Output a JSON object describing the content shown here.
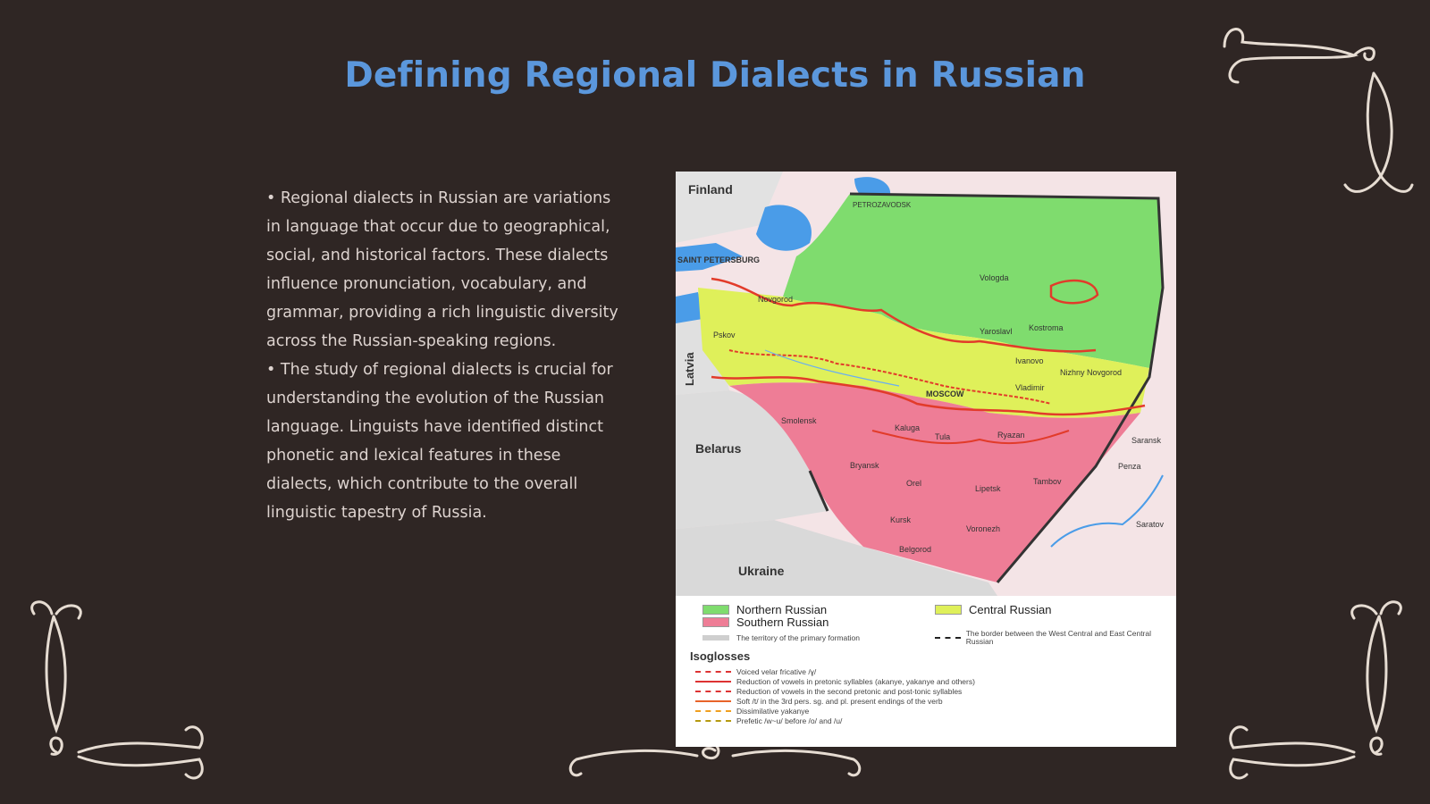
{
  "slide": {
    "title": "Defining Regional Dialects in Russian",
    "bullets": [
      "• Regional dialects in Russian are variations in language that occur due to geographical, social, and historical factors. These dialects influence pronunciation, vocabulary, and grammar, providing a rich linguistic diversity across the Russian-speaking regions.",
      "• The study of regional dialects is crucial for understanding the evolution of the Russian language. Linguists have identified distinct phonetic and lexical features in these dialects, which contribute to the overall linguistic tapestry of Russia."
    ]
  },
  "map": {
    "countries": {
      "finland": "Finland",
      "latvia": "Latvia",
      "belarus": "Belarus",
      "ukraine": "Ukraine"
    },
    "cities": {
      "saint_petersburg": "SAINT PETERSBURG",
      "petrozavodsk": "PETROZAVODSK",
      "novgorod": "Novgorod",
      "pskov": "Pskov",
      "vologda": "Vologda",
      "yaroslavl": "Yaroslavl",
      "kostroma": "Kostroma",
      "ivanovo": "Ivanovo",
      "nizhny_novgorod": "Nizhny Novgorod",
      "vladimir": "Vladimir",
      "moscow": "MOSCOW",
      "smolensk": "Smolensk",
      "kaluga": "Kaluga",
      "tula": "Tula",
      "ryazan": "Ryazan",
      "bryansk": "Bryansk",
      "orel": "Orel",
      "lipetsk": "Lipetsk",
      "tambov": "Tambov",
      "kursk": "Kursk",
      "voronezh": "Voronezh",
      "belgorod": "Belgorod",
      "penza": "Penza",
      "saransk": "Saransk",
      "saratov": "Saratov"
    },
    "legend": {
      "northern": "Northern Russian",
      "central": "Central Russian",
      "southern": "Southern Russian",
      "primary_territory": "The territory of the primary formation",
      "border_note": "The border between the West Central and East Central Russian",
      "isoglosses_heading": "Isoglosses",
      "isoglosses": [
        "Voiced velar fricative /ɣ/",
        "Reduction of vowels in pretonic syllables (akanye, yakanye and others)",
        "Reduction of vowels in the second pretonic and post-tonic syllables",
        "Soft /t/ in the 3rd pers. sg. and pl. present endings of the verb",
        "Dissimilative yakanye",
        "Prefetic /w~u/ before /o/ and /u/"
      ]
    },
    "colors": {
      "northern": "#7fdc6e",
      "central": "#dff05a",
      "southern": "#ee7d96",
      "water": "#4a9ce8",
      "isogloss": "#e23b2a"
    }
  }
}
